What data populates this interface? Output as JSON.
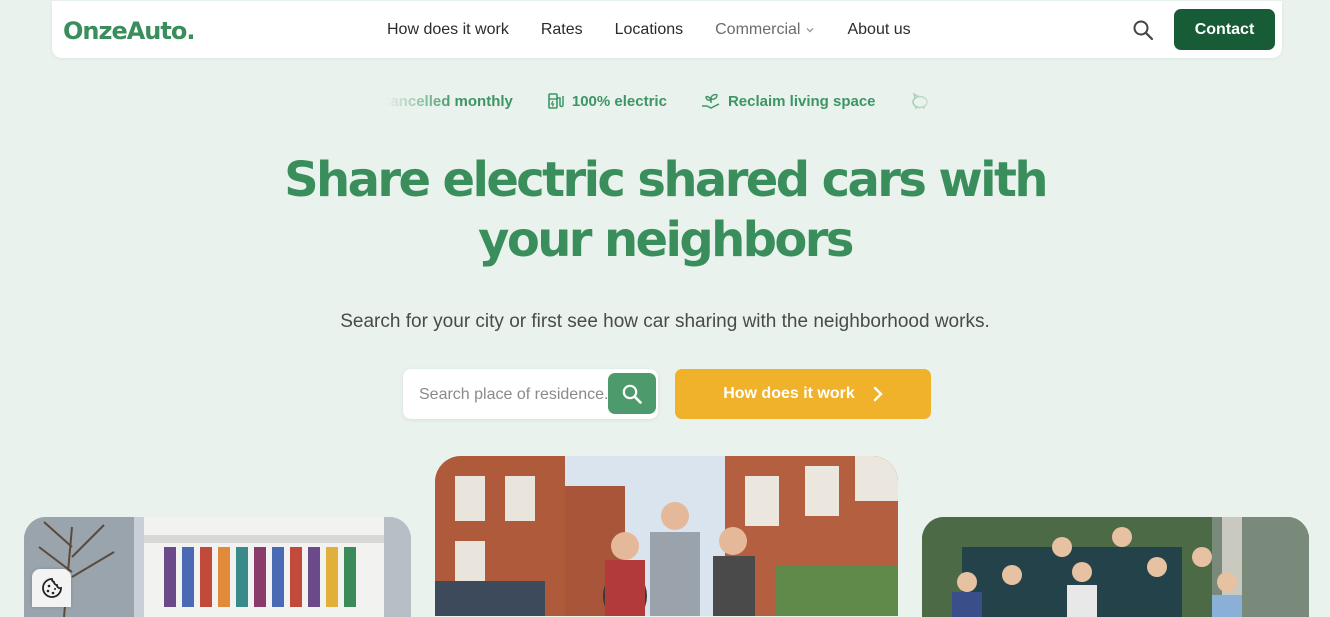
{
  "brand": {
    "logo_text": "OnzeAuto.",
    "primary_color": "#3a8e5c",
    "dark_color": "#185c37",
    "accent_color": "#f0b22a"
  },
  "nav": {
    "items": [
      "How does it work",
      "Rates",
      "Locations",
      "Commercial",
      "About us"
    ],
    "dropdown_item": "Commercial",
    "search_icon": "search-icon",
    "contact_label": "Contact"
  },
  "ticker": {
    "items": [
      {
        "label": "cancelled monthly",
        "icon": "none"
      },
      {
        "label": "100% electric",
        "icon": "charging-station-icon"
      },
      {
        "label": "Reclaim living space",
        "icon": "plant-hand-icon"
      },
      {
        "label": "",
        "icon": "piggy-bank-icon"
      }
    ]
  },
  "hero": {
    "title": "Share electric shared cars with your neighbors",
    "subtitle": "Search for your city or first see how car sharing with the neighborhood works.",
    "search_placeholder": "Search place of residence...",
    "cta_label": "How does it work"
  },
  "photos": {
    "left": "building-with-car-photo",
    "center": "neighbors-group-photo",
    "right": "community-group-photo"
  },
  "cookie": {
    "icon": "cookie-icon"
  }
}
